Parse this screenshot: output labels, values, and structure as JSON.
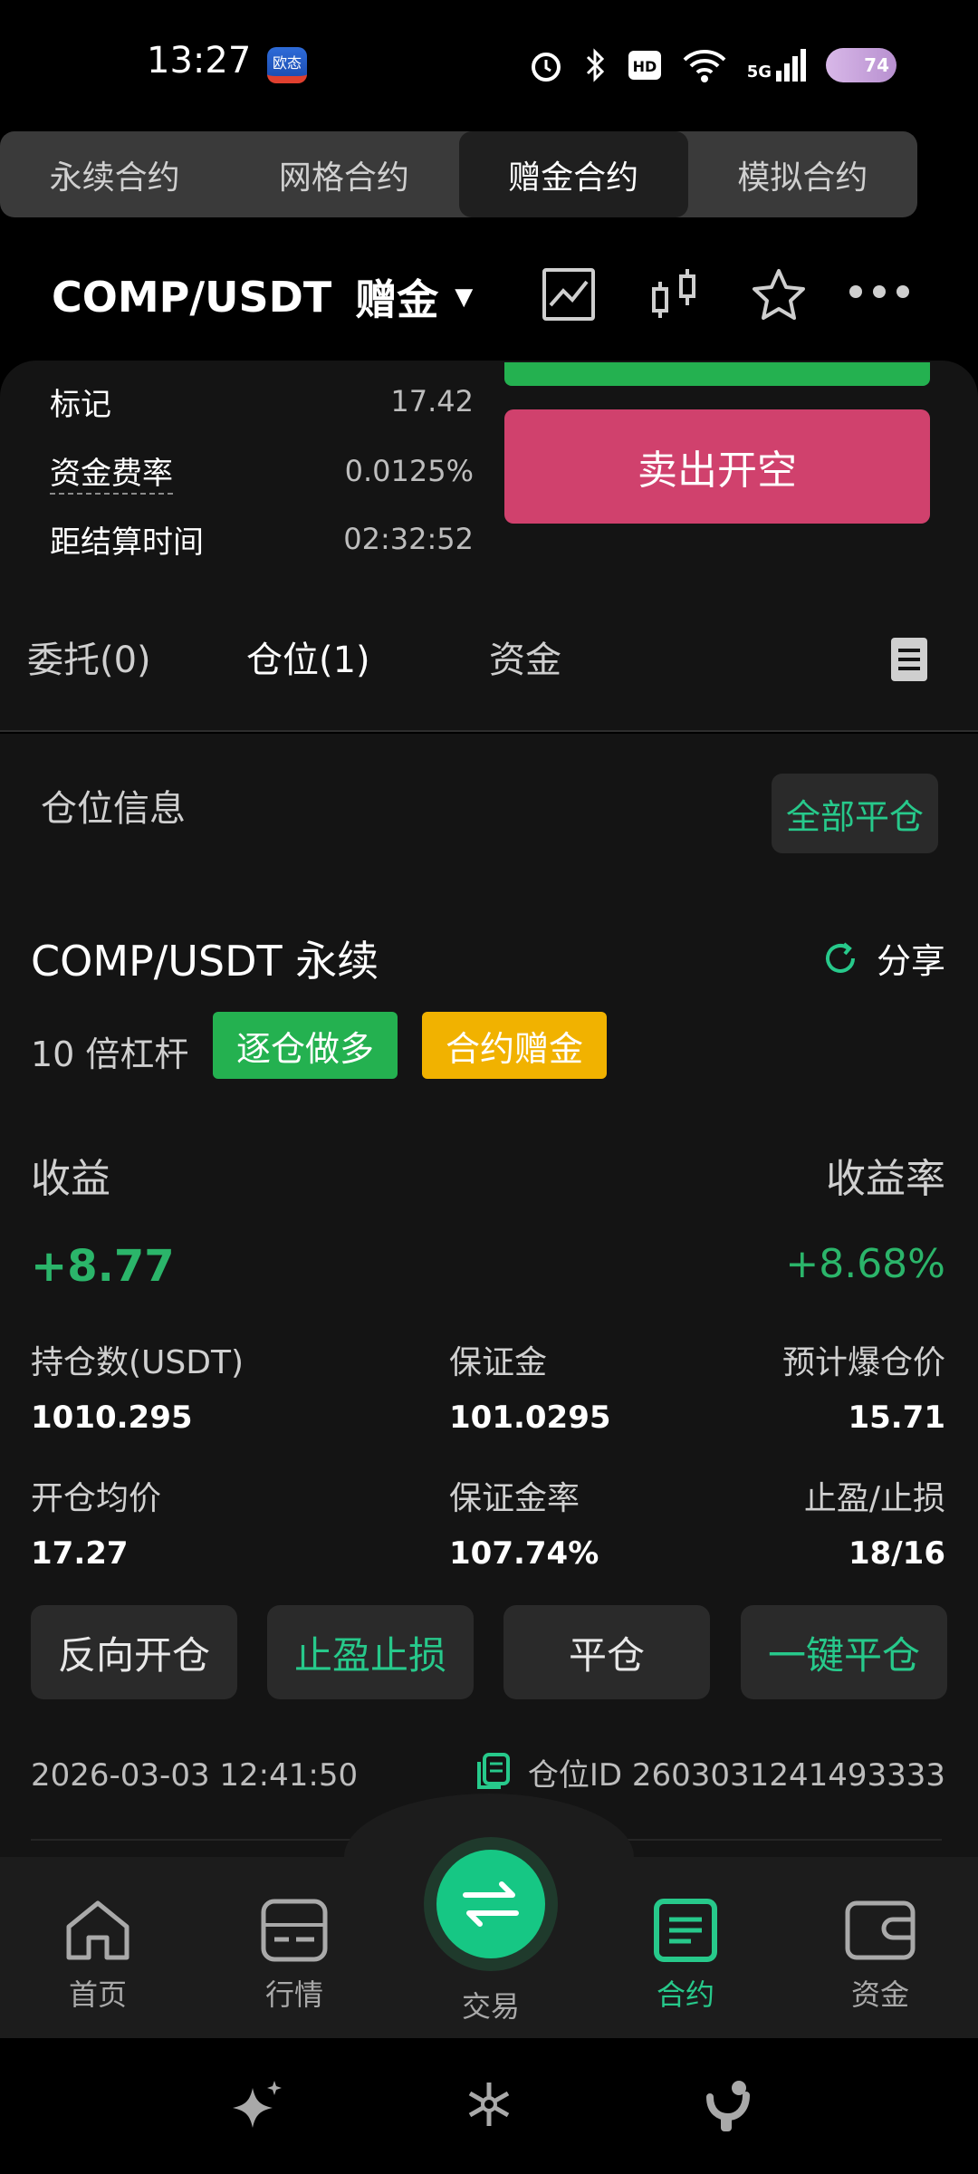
{
  "status_bar": {
    "time": "13:27",
    "app_badge": "欧态",
    "network": "5G",
    "battery": "74"
  },
  "segments": [
    "永续合约",
    "网格合约",
    "赠金合约",
    "模拟合约"
  ],
  "header": {
    "pair": "COMP/USDT",
    "mode": "赠金"
  },
  "trade_panel": {
    "rows": [
      {
        "label": "标记",
        "value": "17.42"
      },
      {
        "label": "资金费率",
        "value": "0.0125%"
      },
      {
        "label": "距结算时间",
        "value": "02:32:52"
      }
    ],
    "sell_label": "卖出开空"
  },
  "pos_tabs": [
    "委托(0)",
    "仓位(1)",
    "资金"
  ],
  "position": {
    "section_label": "仓位信息",
    "close_all_label": "全部平仓",
    "title": "COMP/USDT 永续",
    "share_label": "分享",
    "leverage": "10 倍杠杆",
    "tag_long": "逐仓做多",
    "tag_bonus": "合约赠金",
    "pnl_label": "收益",
    "pnl_value": "+8.77",
    "pnl_rate_label": "收益率",
    "pnl_rate_value": "+8.68%",
    "stats": [
      {
        "label": "持仓数(USDT)",
        "value": "1010.295"
      },
      {
        "label": "保证金",
        "value": "101.0295"
      },
      {
        "label": "预计爆仓价",
        "value": "15.71"
      },
      {
        "label": "开仓均价",
        "value": "17.27"
      },
      {
        "label": "保证金率",
        "value": "107.74%"
      },
      {
        "label": "止盈/止损",
        "value": "18/16"
      }
    ],
    "actions": [
      "反向开仓",
      "止盈止损",
      "平仓",
      "一键平仓"
    ],
    "timestamp": "2026-03-03 12:41:50",
    "position_id": "仓位ID 2603031241493333"
  },
  "bottom_nav": [
    "首页",
    "行情",
    "交易",
    "合约",
    "资金"
  ],
  "colors": {
    "green": "#24b150",
    "accent": "#27c98b",
    "sell": "#d0416d",
    "bonus": "#f1b200"
  }
}
